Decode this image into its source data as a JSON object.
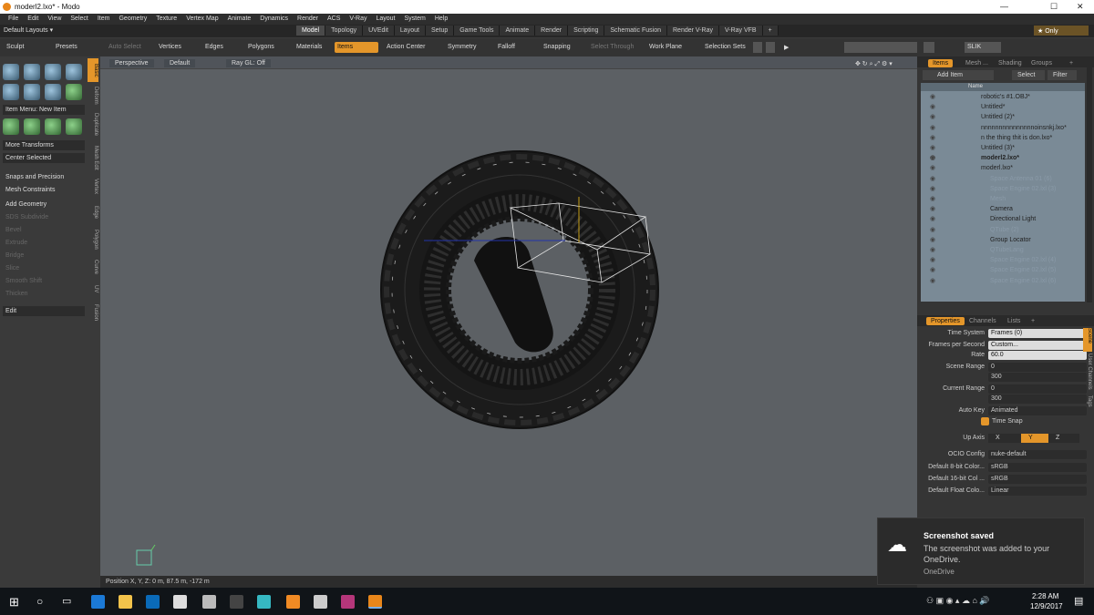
{
  "window": {
    "title": "moderl2.lxo* - Modo",
    "min_label": "—",
    "max_label": "☐",
    "close_label": "✕"
  },
  "menu": [
    "File",
    "Edit",
    "View",
    "Select",
    "Item",
    "Geometry",
    "Texture",
    "Vertex Map",
    "Animate",
    "Dynamics",
    "Render",
    "ACS",
    "V-Ray",
    "Layout",
    "System",
    "Help"
  ],
  "layout_bar": {
    "layout_label": "Default Layouts ▾",
    "tabs": [
      "Model",
      "Topology",
      "UVEdit",
      "Layout",
      "Setup",
      "Game Tools",
      "Animate",
      "Render",
      "Scripting",
      "Schematic Fusion",
      "Render V-Ray",
      "V-Ray VFB",
      "+"
    ],
    "only_label": "★ Only"
  },
  "toolbar": {
    "sculpt": "Sculpt",
    "presets": "Presets",
    "autoselect": "Auto Select",
    "vertices": "Vertices",
    "edges": "Edges",
    "polygons": "Polygons",
    "materials": "Materials",
    "items": "Items",
    "action_center": "Action Center",
    "symmetry": "Symmetry",
    "falloff": "Falloff",
    "snapping": "Snapping",
    "select_through": "Select Through",
    "work_plane": "Work Plane",
    "selection_sets": "Selection Sets",
    "search_text": "SLIK"
  },
  "left_panel": {
    "item_menu": "Item Menu: New Item",
    "more_transforms": "More Transforms",
    "center_selected": "Center Selected",
    "snaps": "Snaps and Precision",
    "mesh_constraints": "Mesh Constraints",
    "add_geometry": "Add Geometry",
    "tools": [
      "SDS Subdivide",
      "Bevel",
      "Extrude",
      "Bridge",
      "Slice",
      "Smooth Shift",
      "Thicken"
    ],
    "edit": "Edit",
    "side_tabs": [
      "Basic",
      "Deform",
      "Duplicate",
      "Mesh Edit",
      "Vertex",
      "Edge",
      "Polygon",
      "Curve",
      "UV",
      "Fusion"
    ]
  },
  "viewport": {
    "perspective": "Perspective",
    "shading": "Default",
    "raygl": "Ray GL: Off",
    "position_readout": "Position X, Y, Z:  0 m, 87.5 m, -172 m"
  },
  "right_panel": {
    "tabs": [
      "Items",
      "Mesh ...",
      "Shading",
      "Groups",
      "+"
    ],
    "add_item": "Add Item",
    "select": "Select",
    "filter": "Filter",
    "name_header": "Name",
    "tree": [
      {
        "label": "robotic's #1.OBJ*",
        "style": "normal"
      },
      {
        "label": "Untitled*",
        "style": "normal"
      },
      {
        "label": "Untitled (2)*",
        "style": "normal"
      },
      {
        "label": "nnnnnnnnnnnnnnnoinsnkj.lxo*",
        "style": "normal"
      },
      {
        "label": "n the thing thit is don.lxo*",
        "style": "normal"
      },
      {
        "label": "Untitled (3)*",
        "style": "normal"
      },
      {
        "label": "moderl2.lxo*",
        "style": "bold"
      },
      {
        "label": "moderl.lxo*",
        "style": "normal"
      },
      {
        "label": "Space Antenna 01 (6)",
        "style": "dim"
      },
      {
        "label": "Space Engine 02.lxl (3)",
        "style": "dim"
      },
      {
        "label": "Mesh",
        "style": "dim"
      },
      {
        "label": "Camera",
        "style": "normal"
      },
      {
        "label": "Directional Light",
        "style": "normal"
      },
      {
        "label": "QTube (2)",
        "style": "dim"
      },
      {
        "label": "Group Locator",
        "style": "normal"
      },
      {
        "label": "QTubeLang",
        "style": "dim"
      },
      {
        "label": "Space Engine 02.lxl (4)",
        "style": "dim"
      },
      {
        "label": "Space Engine 02.lxl (5)",
        "style": "dim"
      },
      {
        "label": "Space Engine 02.lxl (6)",
        "style": "dim"
      }
    ],
    "prop_tabs": [
      "Properties",
      "Channels",
      "Lists",
      "+"
    ],
    "props": {
      "time_system_label": "Time System",
      "time_system": "Frames (0)",
      "fps_label": "Frames per Second",
      "fps": "Custom...",
      "rate_label": "Rate",
      "rate": "60.0",
      "scene_range_label": "Scene Range",
      "scene_start": "0",
      "scene_end": "300",
      "current_range_label": "Current Range",
      "current_start": "0",
      "current_end": "300",
      "autokey_label": "Auto Key",
      "autokey": "Animated",
      "time_snap": "Time Snap",
      "up_axis_label": "Up Axis",
      "axis_x": "X",
      "axis_y": "Y",
      "axis_z": "Z",
      "ocio_label": "OCIO Config",
      "ocio": "nuke-default",
      "c8_label": "Default 8-bit Color...",
      "c8": "sRGB",
      "c16_label": "Default 16-bit Col ...",
      "c16": "sRGB",
      "cf_label": "Default Float Colo...",
      "cf": "Linear"
    },
    "side_tabs": [
      "Scene",
      "User Channels",
      "Tags"
    ]
  },
  "toast": {
    "title": "Screenshot saved",
    "body": "The screenshot was added to your OneDrive.",
    "footer": "OneDrive"
  },
  "taskbar": {
    "time": "2:28 AM",
    "date": "12/9/2017"
  },
  "colors": {
    "accent": "#e4962a",
    "viewport_bg": "#5c6064"
  }
}
